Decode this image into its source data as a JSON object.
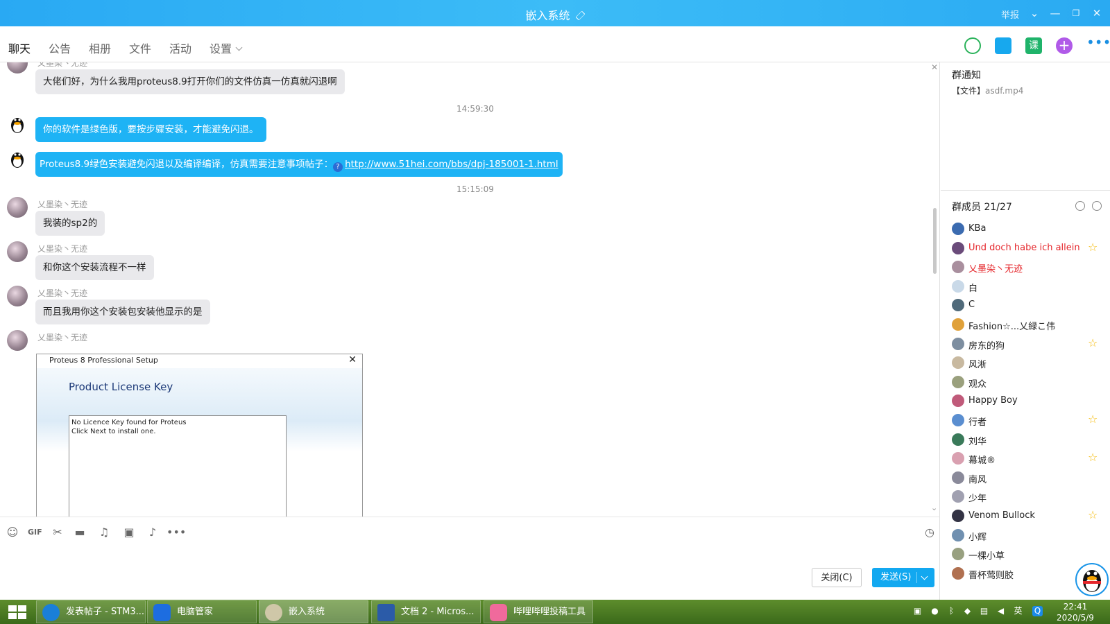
{
  "window": {
    "title": "嵌入系统",
    "report": "举报"
  },
  "tabs": [
    {
      "label": "聊天"
    },
    {
      "label": "公告"
    },
    {
      "label": "相册"
    },
    {
      "label": "文件"
    },
    {
      "label": "活动"
    },
    {
      "label": "设置"
    }
  ],
  "messages": [
    {
      "sender": "乂墨染丶无迹",
      "text": "大佬们好，为什么我用proteus8.9打开你们的文件仿真一仿真就闪退啊"
    },
    {
      "time": "14:59:30"
    },
    {
      "text": "你的软件是绿色版，要按步骤安装，才能避免闪退。"
    },
    {
      "text": "Proteus8.9绿色安装避免闪退以及编译编译，仿真需要注意事项帖子：",
      "link": "http://www.51hei.com/bbs/dpj-185001-1.html"
    },
    {
      "time": "15:15:09"
    },
    {
      "sender": "乂墨染丶无迹",
      "text": "我装的sp2的"
    },
    {
      "sender": "乂墨染丶无迹",
      "text": "和你这个安装流程不一样"
    },
    {
      "sender": "乂墨染丶无迹",
      "text": "而且我用你这个安装包安装他显示的是"
    },
    {
      "sender": "乂墨染丶无迹"
    }
  ],
  "setup_dialog": {
    "title": "Proteus 8 Professional Setup",
    "heading": "Product License Key",
    "line1": "No Licence Key found for Proteus",
    "line2": "Click Next to install one."
  },
  "input": {
    "close_label": "关闭(C)",
    "send_label": "发送(S)"
  },
  "group_notice": {
    "title": "群通知",
    "tag": "【文件】",
    "file": "asdf.mp4"
  },
  "members": {
    "title": "群成员 21/27",
    "list": [
      {
        "name": "KBa"
      },
      {
        "name": "Und doch habe ich allein",
        "red": true,
        "star": true
      },
      {
        "name": "乂墨染丶无迹",
        "red": true
      },
      {
        "name": "白"
      },
      {
        "name": "C"
      },
      {
        "name": "Fashion☆...乂緑こ伟"
      },
      {
        "name": "房东的狗",
        "star": true
      },
      {
        "name": "风淅"
      },
      {
        "name": "观众"
      },
      {
        "name": "Happy Boy"
      },
      {
        "name": "行者",
        "star": true
      },
      {
        "name": "刘华"
      },
      {
        "name": "幕城®",
        "star": true
      },
      {
        "name": "南风"
      },
      {
        "name": "少年"
      },
      {
        "name": "Venom Bullock",
        "star": true
      },
      {
        "name": "小辉"
      },
      {
        "name": "一棵小草"
      },
      {
        "name": "晋杯莺则胶"
      }
    ]
  },
  "taskbar": {
    "items": [
      {
        "label": "发表帖子 - STM3..."
      },
      {
        "label": "电脑管家"
      },
      {
        "label": "嵌入系统"
      },
      {
        "label": "文档 2 - Micros..."
      },
      {
        "label": "哔哩哔哩投稿工具"
      }
    ],
    "ime": "英",
    "time": "22:41",
    "date": "2020/5/9"
  },
  "colors": {
    "accent": "#1eb3f5",
    "title_bar": "#2aaaf2",
    "red_name": "#e5262b"
  }
}
